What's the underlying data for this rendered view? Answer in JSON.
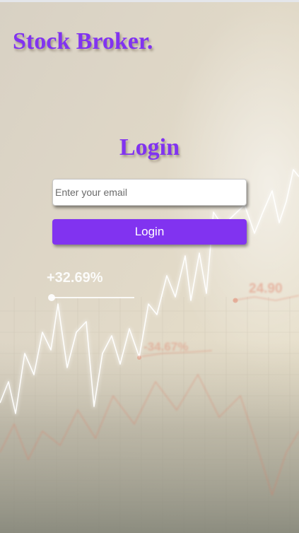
{
  "brand": {
    "name": "Stock Broker."
  },
  "login": {
    "title": "Login",
    "email_placeholder": "Enter your email",
    "email_value": "",
    "button_label": "Login"
  },
  "background": {
    "stat_up": "+32.69%",
    "stat_right": "24.90",
    "stat_down": "-34.67%"
  },
  "colors": {
    "accent": "#8133f0",
    "button_text": "#ffffff"
  }
}
